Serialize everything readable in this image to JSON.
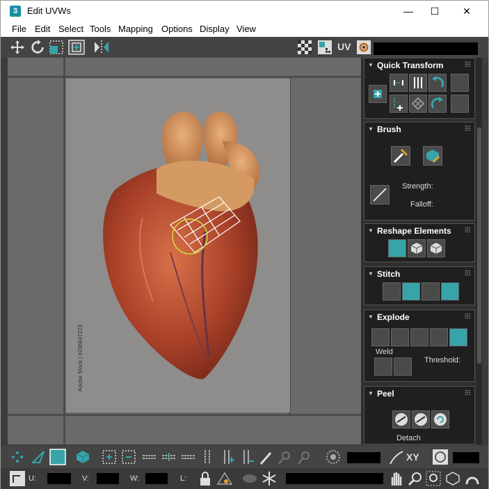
{
  "window": {
    "app_icon": "3",
    "title": "Edit UVWs",
    "minimize": "—",
    "maximize": "☐",
    "close": "✕"
  },
  "menu": [
    "File",
    "Edit",
    "Select",
    "Tools",
    "Mapping",
    "Options",
    "Display",
    "View"
  ],
  "toolbar": {
    "uv_label": "UV"
  },
  "viewport": {
    "watermark": "Adobe Stock | #296847223"
  },
  "rollouts": {
    "quick_transform": "Quick Transform",
    "brush": "Brush",
    "strength_label": "Strength:",
    "falloff_label": "Falloff:",
    "reshape": "Reshape Elements",
    "stitch": "Stitch",
    "explode": "Explode",
    "weld_label": "Weld",
    "threshold_label": "Threshold:",
    "peel": "Peel",
    "detach_label": "Detach"
  },
  "bottom": {
    "xy_label": "XY",
    "u_label": "U:",
    "v_label": "V:",
    "w_label": "W:",
    "l_label": "L:"
  },
  "colors": {
    "accent": "#36a4a8",
    "panel_bg": "#1f1f1f",
    "toolbar_bg": "#444444"
  }
}
